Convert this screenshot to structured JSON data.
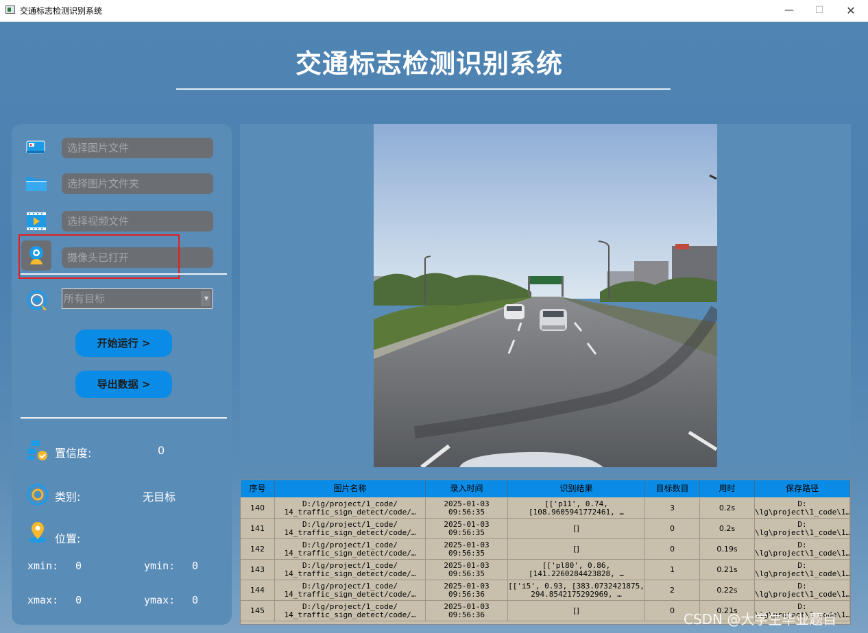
{
  "window": {
    "title": "交通标志检测识别系统",
    "minimize": "—",
    "maximize": "☐",
    "close": "✕"
  },
  "app": {
    "title": "交通标志检测识别系统"
  },
  "sidebar": {
    "image_file_placeholder": "选择图片文件",
    "image_folder_placeholder": "选择图片文件夹",
    "video_file_placeholder": "选择视频文件",
    "camera_status": "摄像头已打开",
    "target_select": "所有目标",
    "start_button": "开始运行 >",
    "export_button": "导出数据 >"
  },
  "stats": {
    "confidence_label": "置信度:",
    "confidence_value": "0",
    "category_label": "类别:",
    "category_value": "无目标",
    "position_label": "位置:",
    "xmin_label": "xmin:",
    "xmin_value": "0",
    "ymin_label": "ymin:",
    "ymin_value": "0",
    "xmax_label": "xmax:",
    "xmax_value": "0",
    "ymax_label": "ymax:",
    "ymax_value": "0"
  },
  "table": {
    "columns": [
      "序号",
      "图片名称",
      "录入时间",
      "识别结果",
      "目标数目",
      "用时",
      "保存路径"
    ],
    "rows": [
      {
        "id": "140",
        "name1": "D:/lg/project/1_code/",
        "name2": "14_traffic_sign_detect/code/…",
        "time1": "2025-01-03",
        "time2": "09:56:35",
        "res1": "[['p11', 0.74,",
        "res2": "[108.9605941772461, …",
        "count": "3",
        "used": "0.2s",
        "path1": "D:",
        "path2": "\\lg\\project\\1_code\\1…"
      },
      {
        "id": "141",
        "name1": "D:/lg/project/1_code/",
        "name2": "14_traffic_sign_detect/code/…",
        "time1": "2025-01-03",
        "time2": "09:56:35",
        "res1": "[]",
        "res2": "",
        "count": "0",
        "used": "0.2s",
        "path1": "D:",
        "path2": "\\lg\\project\\1_code\\1…"
      },
      {
        "id": "142",
        "name1": "D:/lg/project/1_code/",
        "name2": "14_traffic_sign_detect/code/…",
        "time1": "2025-01-03",
        "time2": "09:56:35",
        "res1": "[]",
        "res2": "",
        "count": "0",
        "used": "0.19s",
        "path1": "D:",
        "path2": "\\lg\\project\\1_code\\1…"
      },
      {
        "id": "143",
        "name1": "D:/lg/project/1_code/",
        "name2": "14_traffic_sign_detect/code/…",
        "time1": "2025-01-03",
        "time2": "09:56:35",
        "res1": "[['pl80', 0.86,",
        "res2": "[141.2260284423828, …",
        "count": "1",
        "used": "0.21s",
        "path1": "D:",
        "path2": "\\lg\\project\\1_code\\1…"
      },
      {
        "id": "144",
        "name1": "D:/lg/project/1_code/",
        "name2": "14_traffic_sign_detect/code/…",
        "time1": "2025-01-03",
        "time2": "09:56:36",
        "res1": "[['i5', 0.93, [383.0732421875,",
        "res2": "294.8542175292969, …",
        "count": "2",
        "used": "0.22s",
        "path1": "D:",
        "path2": "\\lg\\project\\1_code\\1…"
      },
      {
        "id": "145",
        "name1": "D:/lg/project/1_code/",
        "name2": "14_traffic_sign_detect/code/…",
        "time1": "2025-01-03",
        "time2": "09:56:36",
        "res1": "[]",
        "res2": "",
        "count": "0",
        "used": "0.21s",
        "path1": "D:",
        "path2": "\\lg\\project\\1_code\\1…"
      }
    ]
  },
  "watermark": "CSDN @大学生毕业题目",
  "colors": {
    "accent": "#0a8ce6",
    "panel": "#5a8cb8",
    "field": "#6b6f74",
    "highlight": "#e02020"
  }
}
